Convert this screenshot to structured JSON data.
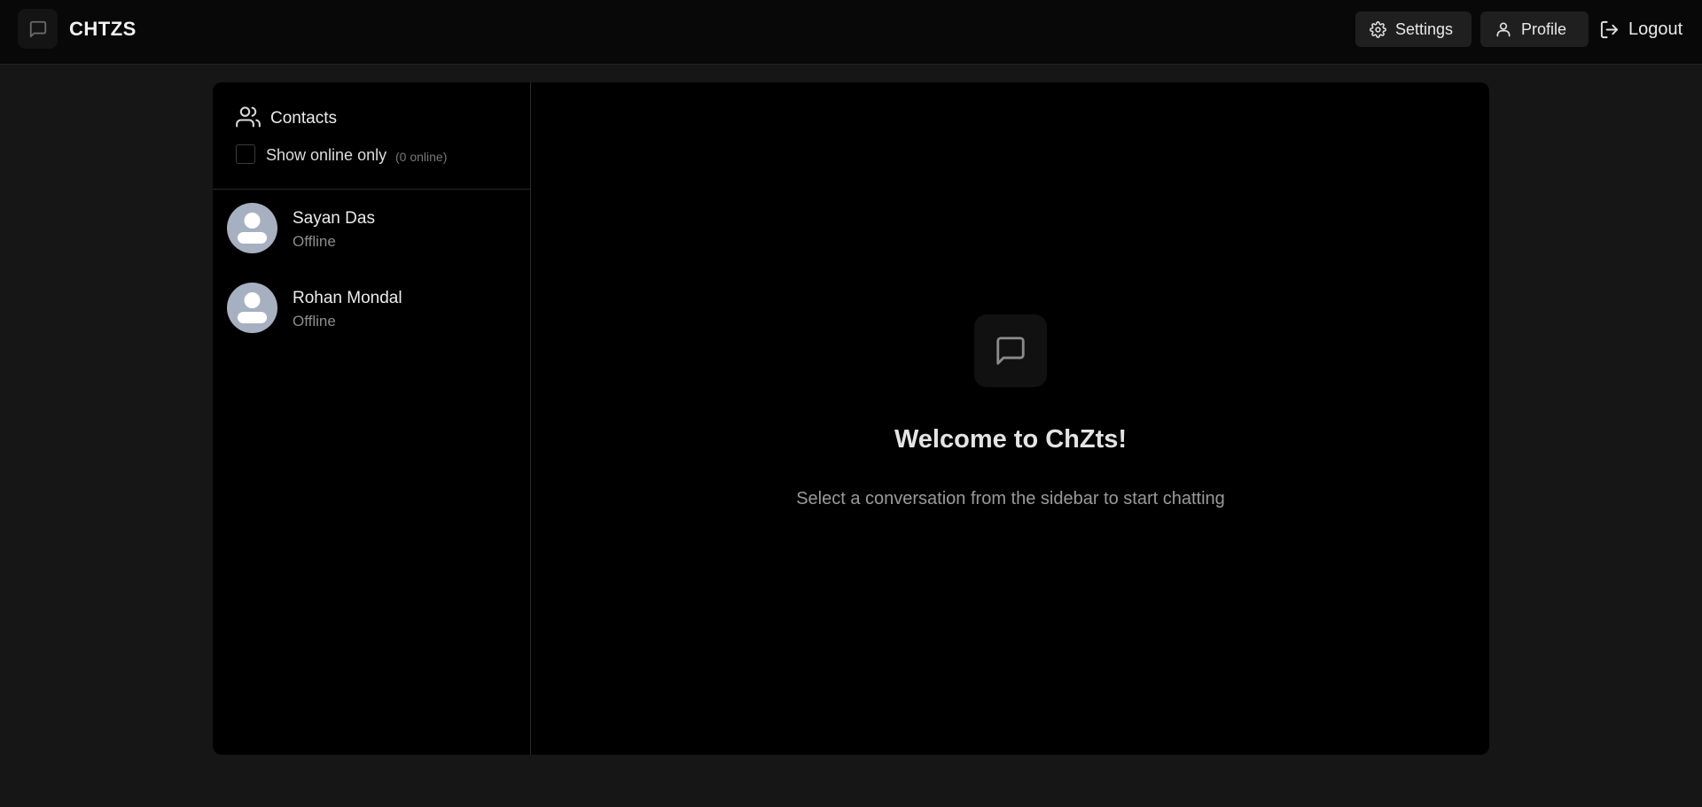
{
  "header": {
    "app_name": "CHTZS",
    "settings_label": "Settings",
    "profile_label": "Profile",
    "logout_label": "Logout"
  },
  "sidebar": {
    "title": "Contacts",
    "filter_label": "Show online only",
    "online_count": "(0 online)",
    "contacts": [
      {
        "name": "Sayan Das",
        "status": "Offline"
      },
      {
        "name": "Rohan Mondal",
        "status": "Offline"
      }
    ]
  },
  "welcome": {
    "title": "Welcome to ChZts!",
    "subtitle": "Select a conversation from the sidebar to start chatting"
  },
  "colors": {
    "background": "#161616",
    "card": "#000000",
    "avatar": "#a7b0c0"
  },
  "icons": [
    "message-square-icon",
    "gear-icon",
    "user-icon",
    "logout-icon",
    "users-icon"
  ]
}
